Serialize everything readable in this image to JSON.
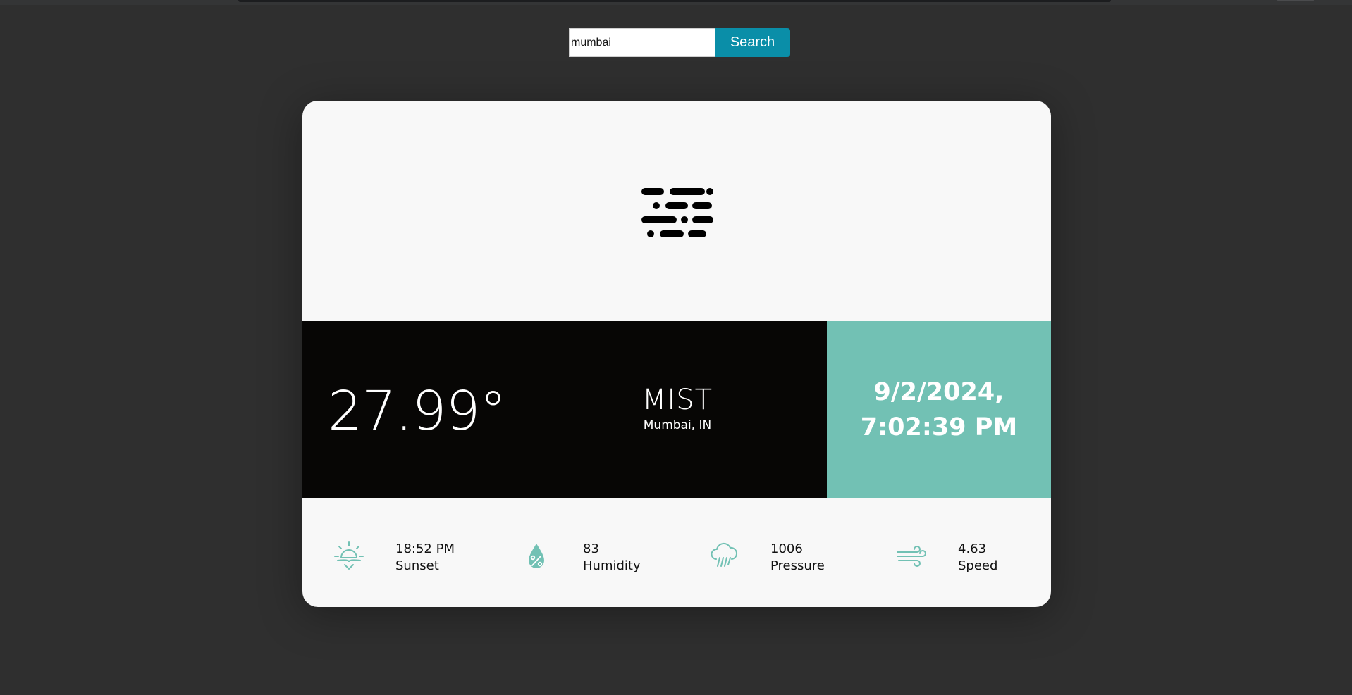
{
  "search": {
    "value": "mumbai",
    "button_label": "Search"
  },
  "weather": {
    "icon": "mist-icon",
    "temperature": "27.99°",
    "condition": "MIST",
    "location": "Mumbai, IN",
    "date": "9/2/2024,",
    "time": "7:02:39 PM"
  },
  "stats": [
    {
      "icon": "sunset-icon",
      "value": "18:52 PM",
      "label": "Sunset"
    },
    {
      "icon": "humidity-icon",
      "value": "83",
      "label": "Humidity"
    },
    {
      "icon": "pressure-icon",
      "value": "1006",
      "label": "Pressure"
    },
    {
      "icon": "wind-icon",
      "value": "4.63",
      "label": "Speed"
    }
  ],
  "colors": {
    "page_background": "#2f2f2f",
    "card_background": "#f8f8f8",
    "dark_band": "#070605",
    "accent": "#72c1b4",
    "search_button": "#0a8ea8"
  }
}
